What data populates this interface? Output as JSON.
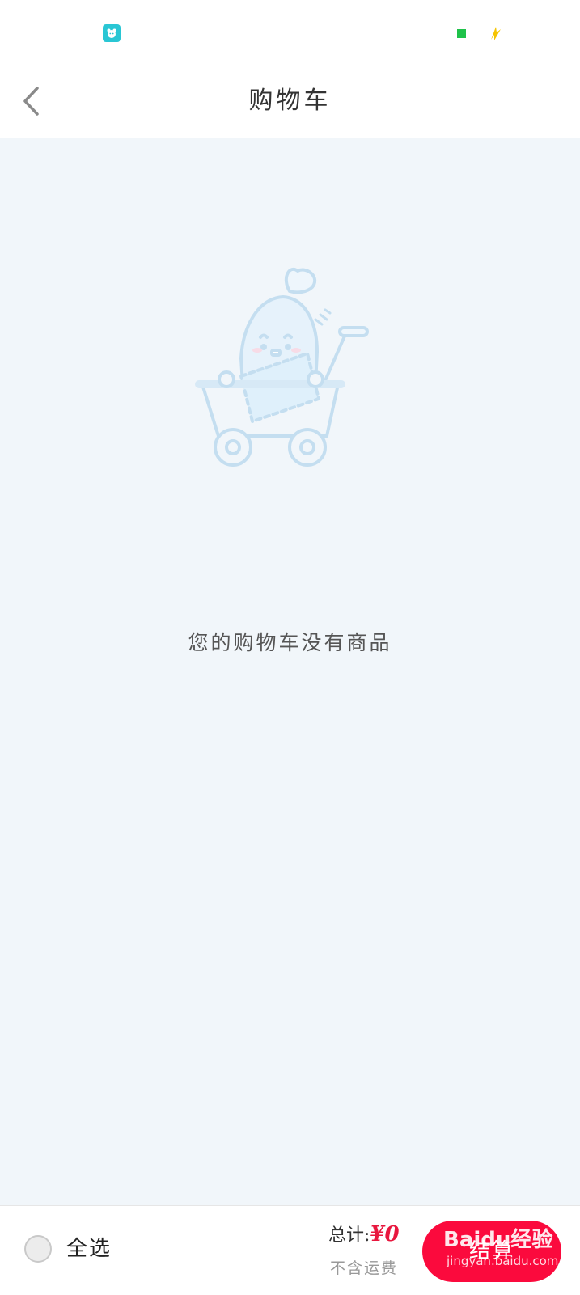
{
  "status_bar": {
    "notif_icon": "app-notification-icon",
    "signal_icon": "signal-icon",
    "charge_icon": "charging-icon",
    "colors": {
      "notif": "#29c6d4",
      "signal": "#1fc24a",
      "charge": "#f5c400"
    }
  },
  "header": {
    "title": "购物车",
    "back_icon": "chevron-left-icon"
  },
  "empty_state": {
    "illustration": "shopping-cart-mascot-illustration",
    "message": "您的购物车没有商品"
  },
  "footer": {
    "select_all_label": "全选",
    "total_label": "总计:",
    "total_amount": "¥0",
    "shipping_note": "不含运费",
    "checkout_label": "结算",
    "accent_color": "#fb0a3d"
  },
  "watermark": {
    "brand": "Baidu经验",
    "url": "jingyan.baidu.com"
  }
}
